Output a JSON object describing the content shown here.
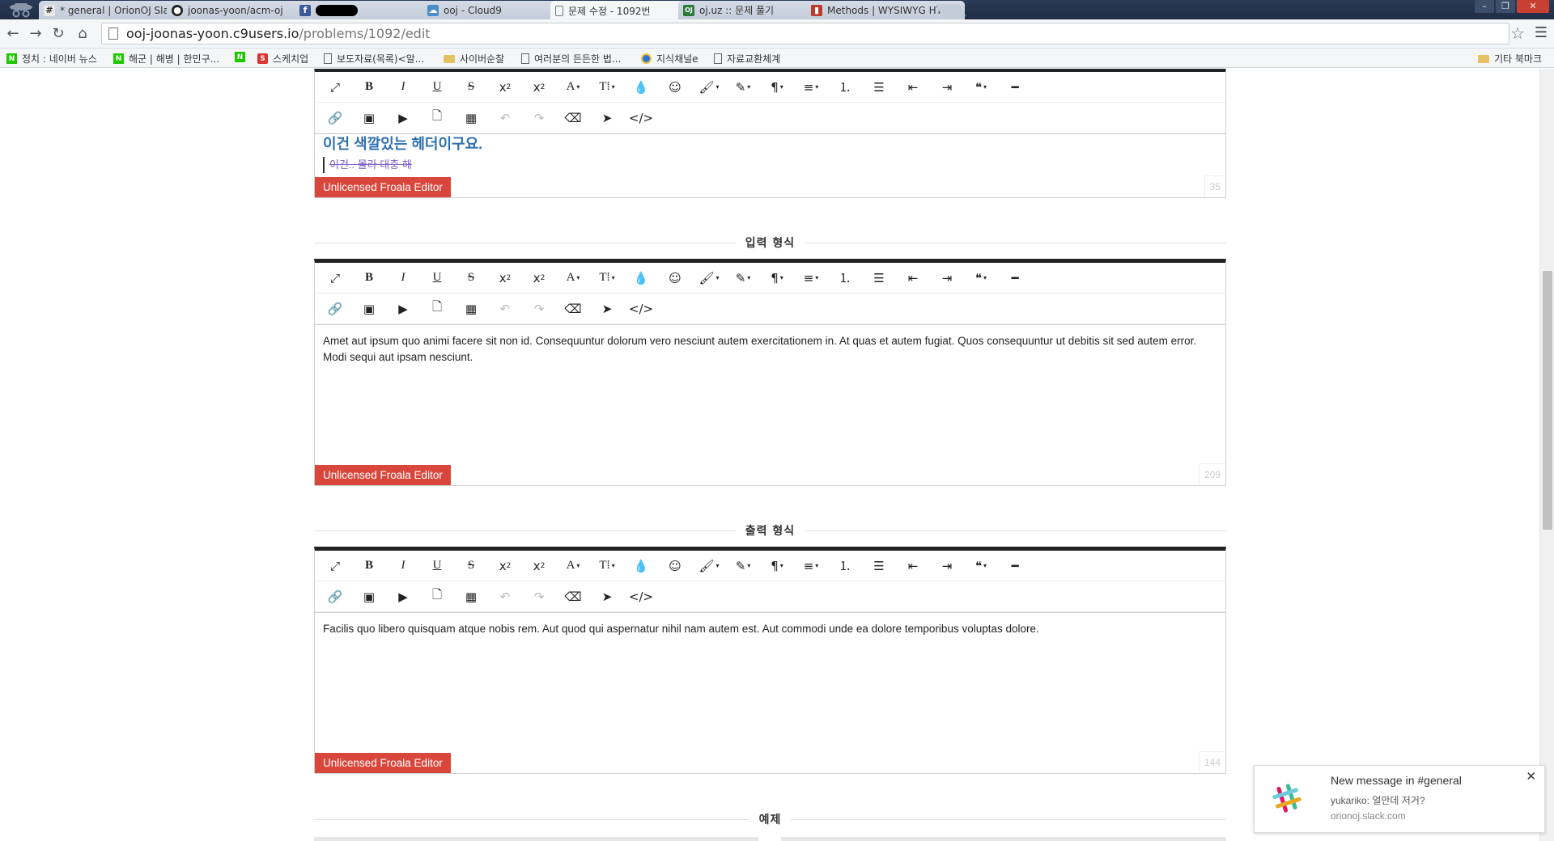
{
  "tabs": [
    {
      "title": "* general | OrionOJ Slack",
      "icon": "#",
      "active": false
    },
    {
      "title": "joonas-yoon/acm-oj",
      "icon": "github",
      "active": false
    },
    {
      "title": "",
      "icon": "f",
      "active": false
    },
    {
      "title": "ooj - Cloud9",
      "icon": "cloud9",
      "active": false
    },
    {
      "title": "문제 수정 - 1092번",
      "icon": "page",
      "active": true
    },
    {
      "title": "oj.uz :: 문제 풀기",
      "icon": "OJ",
      "active": false
    },
    {
      "title": "Methods | WYSIWYG HTM",
      "icon": "froala",
      "active": false
    }
  ],
  "url": {
    "host": "ooj-joonas-yoon.c9users.io",
    "path": "/problems/1092/edit"
  },
  "bookmarks": [
    {
      "label": "정치 : 네이버 뉴스",
      "icon": "naver"
    },
    {
      "label": "해군 | 해병 | 한민구...",
      "icon": "naver"
    },
    {
      "label": "",
      "icon": "naver"
    },
    {
      "label": "스케치업",
      "icon": "sketch"
    },
    {
      "label": "보도자료(목록)<알...",
      "icon": "doc"
    },
    {
      "label": "사이버순찰",
      "icon": "folder"
    },
    {
      "label": "여러분의 든든한 법...",
      "icon": "doc"
    },
    {
      "label": "지식채널e",
      "icon": "orb"
    },
    {
      "label": "자료교환체계",
      "icon": "doc"
    },
    {
      "label": "기타 북마크",
      "icon": "folder"
    }
  ],
  "editors": [
    {
      "header_text": "이건 색깔있는 헤더이구요.",
      "strike_text": "이건.. 몰라 대충 해",
      "badge": "Unlicensed Froala Editor",
      "count": "35"
    },
    {
      "section": "입력 형식",
      "body": "Amet aut ipsum quo animi facere sit non id. Consequuntur dolorum vero nesciunt autem exercitationem in. At quas et autem fugiat. Quos consequuntur ut debitis sit sed autem error. Modi sequi aut ipsam nesciunt.",
      "badge": "Unlicensed Froala Editor",
      "count": "209"
    },
    {
      "section": "출력 형식",
      "body": "Facilis quo libero quisquam atque nobis rem. Aut quod qui aspernatur nihil nam autem est. Aut commodi unde ea dolore temporibus voluptas dolore.",
      "badge": "Unlicensed Froala Editor",
      "count": "144"
    }
  ],
  "next_section": "예제",
  "notification": {
    "title": "New message in #general",
    "message": "yukariko: 얼만데 저거?",
    "source": "orionoj.slack.com"
  },
  "toolbar_row1": [
    "fullscreen-icon",
    "bold-icon",
    "italic-icon",
    "underline-icon",
    "strikethrough-icon",
    "subscript-icon",
    "superscript-icon",
    "font-family-icon",
    "font-size-icon",
    "color-icon",
    "emoticons-icon",
    "inline-style-icon",
    "paragraph-style-icon",
    "paragraph-format-icon",
    "align-icon",
    "ordered-list-icon",
    "unordered-list-icon",
    "outdent-icon",
    "indent-icon",
    "quote-icon",
    "horizontal-line-icon"
  ],
  "toolbar_row2": [
    "link-icon",
    "image-icon",
    "video-icon",
    "file-icon",
    "table-icon",
    "undo-icon",
    "redo-icon",
    "clear-formatting-icon",
    "select-all-icon",
    "code-view-icon"
  ],
  "colors": {
    "badge": "#d9463c",
    "header_text": "#2f6fb1",
    "strike_text": "#7d5fc6",
    "toolbar_border": "#222222"
  }
}
